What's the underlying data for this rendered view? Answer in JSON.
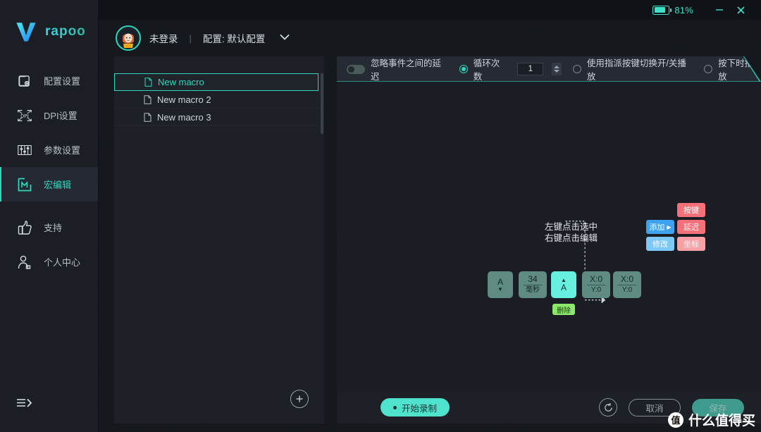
{
  "titlebar": {
    "battery_percent": "81%",
    "battery_level": 81,
    "minimize_label": "",
    "close_label": ""
  },
  "sidebar": {
    "logo_text": "rapoo",
    "items": [
      {
        "label": "配置设置",
        "icon": "profile-settings-icon",
        "active": false
      },
      {
        "label": "DPI设置",
        "icon": "dpi-settings-icon",
        "active": false
      },
      {
        "label": "参数设置",
        "icon": "parameter-settings-icon",
        "active": false
      },
      {
        "label": "宏编辑",
        "icon": "macro-editor-icon",
        "active": true
      },
      {
        "label": "支持",
        "icon": "thumbs-up-icon",
        "active": false
      },
      {
        "label": "个人中心",
        "icon": "user-center-icon",
        "active": false
      }
    ],
    "collapse_icon": "expand-menu-icon"
  },
  "header": {
    "login_status": "未登录",
    "separator": "|",
    "profile_label": "配置: 默认配置",
    "dropdown_icon": "chevron-down-icon",
    "avatar_icon": "user-avatar"
  },
  "macro_list": {
    "items": [
      {
        "name": "New macro",
        "selected": true
      },
      {
        "name": "New macro 2",
        "selected": false
      },
      {
        "name": "New macro 3",
        "selected": false
      }
    ],
    "add_button_icon": "plus-icon"
  },
  "toolbar": {
    "ignore_delay_label": "忽略事件之间的延迟",
    "ignore_delay_on": false,
    "loop_count_label": "循环次数",
    "loop_count_selected": true,
    "loop_count_value": "1",
    "toggle_play_label": "使用指派按键切换开/关播放",
    "toggle_play_selected": false,
    "press_play_label": "按下时播放",
    "press_play_selected": false
  },
  "diagram": {
    "hint_line1": "左键点击选中",
    "hint_line2": "右键点击编辑",
    "context_menu": [
      {
        "label": "添加",
        "has_arrow": true,
        "color": "#3da2ef"
      },
      {
        "label": "修改",
        "has_arrow": false,
        "color": "#7cc8f7"
      }
    ],
    "submenu": [
      {
        "label": "按键",
        "color": "#f4717a"
      },
      {
        "label": "延迟",
        "color": "#f4717a"
      },
      {
        "label": "坐标",
        "color": "#f7a0a6"
      }
    ],
    "events": [
      {
        "type": "key-down",
        "top": "A",
        "bottom": "",
        "caret": "down",
        "highlight": false
      },
      {
        "type": "delay",
        "top": "34",
        "bottom": "毫秒",
        "caret": "none",
        "highlight": false
      },
      {
        "type": "key-up",
        "top": "A",
        "bottom": "",
        "caret": "up",
        "highlight": true
      },
      {
        "type": "coordinate",
        "top": "X:0",
        "bottom": "Y:0",
        "caret": "none",
        "highlight": false
      },
      {
        "type": "coordinate",
        "top": "X:0",
        "bottom": "Y:0",
        "caret": "none",
        "highlight": false
      }
    ],
    "delete_label": "删除"
  },
  "bottombar": {
    "record_label": "开始录制",
    "reset_icon": "refresh-icon",
    "cancel_label": "取消",
    "save_label": "保存"
  },
  "watermark": {
    "badge": "值",
    "text": "什么值得买"
  }
}
